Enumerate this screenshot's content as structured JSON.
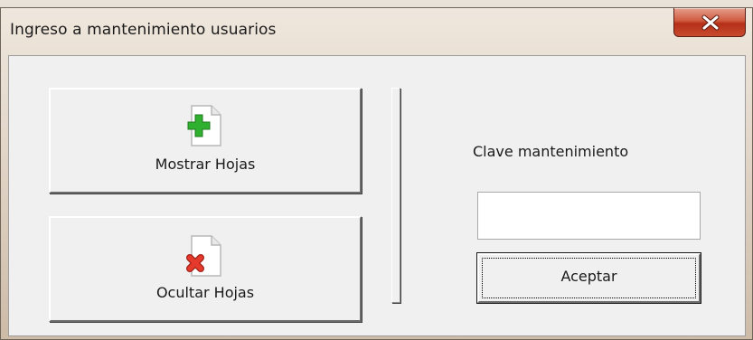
{
  "window": {
    "title": "Ingreso a mantenimiento usuarios",
    "close_icon": "close-x-icon"
  },
  "buttons": {
    "show_sheets": {
      "label": "Mostrar Hojas",
      "icon": "document-add-icon"
    },
    "hide_sheets": {
      "label": "Ocultar Hojas",
      "icon": "document-remove-icon"
    }
  },
  "maintenance": {
    "key_label": "Clave mantenimiento",
    "key_value": "",
    "accept_label": "Aceptar"
  },
  "colors": {
    "add_green": "#2fb02f",
    "remove_red": "#e53a2b",
    "close_red": "#c84a2f"
  }
}
